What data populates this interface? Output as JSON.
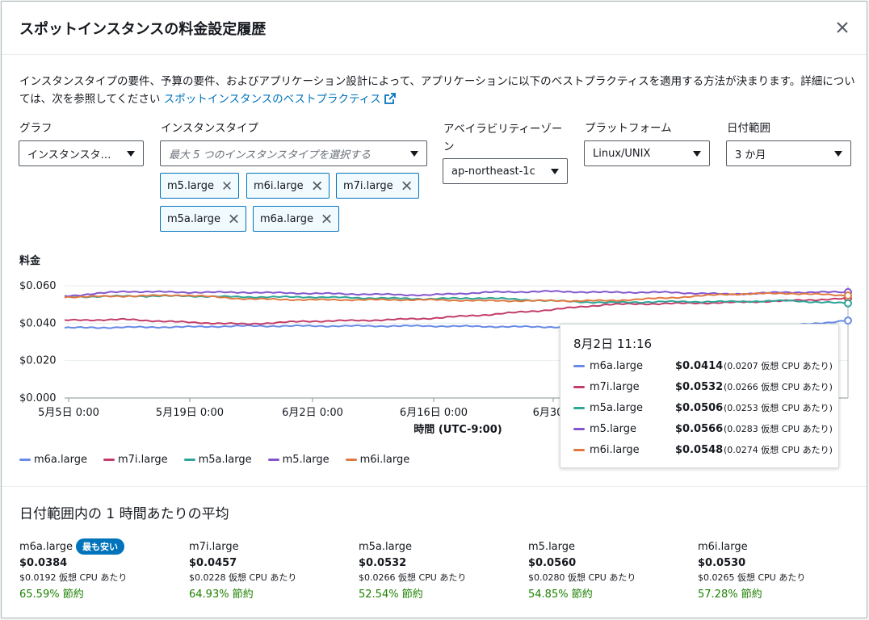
{
  "modal": {
    "title": "スポットインスタンスの料金設定履歴",
    "description": "インスタンスタイプの要件、予算の要件、およびアプリケーション設計によって、アプリケーションに以下のベストプラクティスを適用する方法が決まります。詳細については、次を参照してください",
    "link_text": "スポットインスタンスのベストプラクティス"
  },
  "filters": {
    "graph": {
      "label": "グラフ",
      "value": "インスタンスタ…"
    },
    "instance_type": {
      "label": "インスタンスタイプ",
      "placeholder": "最大 5 つのインスタンスタイプを選択する"
    },
    "az": {
      "label": "アベイラビリティーゾーン",
      "value": "ap-northeast-1c"
    },
    "platform": {
      "label": "プラットフォーム",
      "value": "Linux/UNIX"
    },
    "date_range": {
      "label": "日付範囲",
      "value": "3 か月"
    }
  },
  "tokens": [
    "m5.large",
    "m6i.large",
    "m7i.large",
    "m5a.large",
    "m6a.large"
  ],
  "chart_data": {
    "type": "line",
    "title": "料金",
    "xlabel": "時間 (UTC-9:00)",
    "ylabel": "料金",
    "ylim": [
      0,
      0.06
    ],
    "yticks": [
      "$0.000",
      "$0.020",
      "$0.040",
      "$0.060"
    ],
    "xticks": [
      "5月5日 0:00",
      "5月19日 0:00",
      "6月2日 0:00",
      "6月16日 0:00",
      "6月30日"
    ],
    "x": [
      "5/5",
      "5/12",
      "5/19",
      "5/26",
      "6/2",
      "6/9",
      "6/16",
      "6/23",
      "6/30",
      "7/7",
      "7/14",
      "7/21",
      "7/28",
      "8/2"
    ],
    "series": [
      {
        "name": "m6a.large",
        "color": "#688ae8",
        "values": [
          0.0375,
          0.0378,
          0.038,
          0.0385,
          0.0385,
          0.0385,
          0.0385,
          0.0382,
          0.038,
          0.0378,
          0.038,
          0.0382,
          0.0385,
          0.0414
        ]
      },
      {
        "name": "m7i.large",
        "color": "#c33d69",
        "values": [
          0.0415,
          0.042,
          0.0405,
          0.0395,
          0.041,
          0.0415,
          0.0425,
          0.0445,
          0.047,
          0.05,
          0.0505,
          0.051,
          0.052,
          0.0532
        ]
      },
      {
        "name": "m5a.large",
        "color": "#2ea597",
        "values": [
          0.054,
          0.0545,
          0.0545,
          0.054,
          0.054,
          0.0535,
          0.053,
          0.0535,
          0.052,
          0.051,
          0.0515,
          0.0515,
          0.052,
          0.0506
        ]
      },
      {
        "name": "m5.large",
        "color": "#8456ce",
        "values": [
          0.0545,
          0.057,
          0.0565,
          0.0565,
          0.056,
          0.0555,
          0.055,
          0.0565,
          0.057,
          0.0565,
          0.0565,
          0.0555,
          0.0565,
          0.0566
        ]
      },
      {
        "name": "m6i.large",
        "color": "#e07941",
        "values": [
          0.054,
          0.0545,
          0.055,
          0.053,
          0.0525,
          0.0525,
          0.0525,
          0.052,
          0.052,
          0.052,
          0.0535,
          0.0555,
          0.056,
          0.0548
        ]
      }
    ]
  },
  "tooltip": {
    "title": "8月2日 11:16",
    "rows": [
      {
        "name": "m6a.large",
        "price": "$0.0414",
        "cpu": "(0.0207 仮想 CPU あたり)",
        "color": "#688ae8"
      },
      {
        "name": "m7i.large",
        "price": "$0.0532",
        "cpu": "(0.0266 仮想 CPU あたり)",
        "color": "#c33d69"
      },
      {
        "name": "m5a.large",
        "price": "$0.0506",
        "cpu": "(0.0253 仮想 CPU あたり)",
        "color": "#2ea597"
      },
      {
        "name": "m5.large",
        "price": "$0.0566",
        "cpu": "(0.0283 仮想 CPU あたり)",
        "color": "#8456ce"
      },
      {
        "name": "m6i.large",
        "price": "$0.0548",
        "cpu": "(0.0274 仮想 CPU あたり)",
        "color": "#e07941"
      }
    ]
  },
  "averages": {
    "title": "日付範囲内の 1 時間あたりの平均",
    "cheapest_badge": "最も安い",
    "items": [
      {
        "name": "m6a.large",
        "price": "$0.0384",
        "cpu": "$0.0192 仮想 CPU あたり",
        "saving": "65.59% 節約"
      },
      {
        "name": "m7i.large",
        "price": "$0.0457",
        "cpu": "$0.0228 仮想 CPU あたり",
        "saving": "64.93% 節約"
      },
      {
        "name": "m5a.large",
        "price": "$0.0532",
        "cpu": "$0.0266 仮想 CPU あたり",
        "saving": "52.54% 節約"
      },
      {
        "name": "m5.large",
        "price": "$0.0560",
        "cpu": "$0.0280 仮想 CPU あたり",
        "saving": "54.85% 節約"
      },
      {
        "name": "m6i.large",
        "price": "$0.0530",
        "cpu": "$0.0265 仮想 CPU あたり",
        "saving": "57.28% 節約"
      }
    ]
  }
}
